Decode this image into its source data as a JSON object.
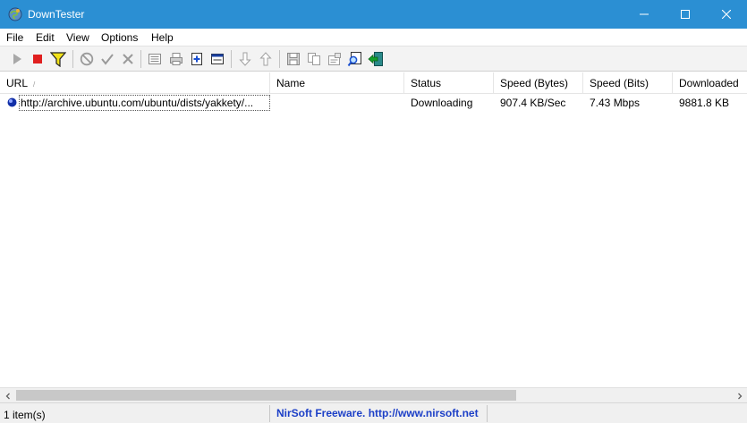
{
  "window": {
    "title": "DownTester",
    "accent_color": "#2b8fd3",
    "controls": [
      "minimize-icon",
      "maximize-icon",
      "close-icon"
    ]
  },
  "menu": [
    {
      "label": "File"
    },
    {
      "label": "Edit"
    },
    {
      "label": "View"
    },
    {
      "label": "Options"
    },
    {
      "label": "Help"
    }
  ],
  "toolbar": {
    "buttons": [
      "start-icon",
      "stop-icon",
      "filter-icon",
      "cancel-icon",
      "check-icon",
      "remove-icon",
      "list-icon",
      "print-icon",
      "add-url-icon",
      "window-icon",
      "move-down-icon",
      "move-up-icon",
      "save-icon",
      "copy-icon",
      "properties-icon",
      "find-icon",
      "exit-icon"
    ]
  },
  "columns": [
    {
      "label": "URL"
    },
    {
      "label": "Name"
    },
    {
      "label": "Status"
    },
    {
      "label": "Speed (Bytes)"
    },
    {
      "label": "Speed (Bits)"
    },
    {
      "label": "Downloaded"
    }
  ],
  "rows": [
    {
      "url": "http://archive.ubuntu.com/ubuntu/dists/yakkety/...",
      "name": "",
      "status": "Downloading",
      "speed_bytes": "907.4 KB/Sec",
      "speed_bits": "7.43 Mbps",
      "downloaded": "9881.8 KB",
      "icon": "globe-icon"
    }
  ],
  "status": {
    "count": "1 item(s)",
    "credit": "NirSoft Freeware.  http://www.nirsoft.net",
    "credit_color": "#1c3fc7"
  }
}
